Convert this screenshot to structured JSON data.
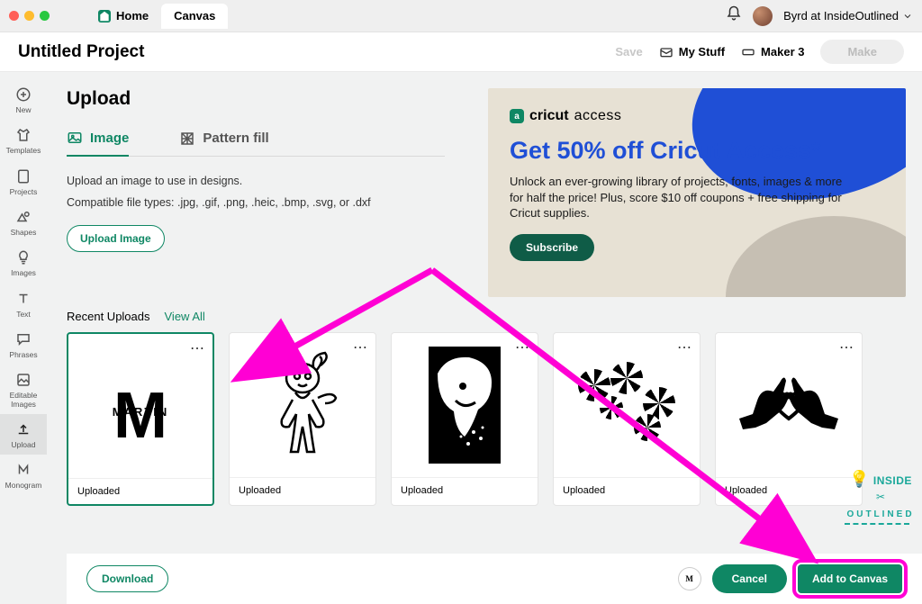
{
  "topbar": {
    "tabs": [
      {
        "label": "Home",
        "active": false
      },
      {
        "label": "Canvas",
        "active": true
      }
    ],
    "user_name": "Byrd at InsideOutlined"
  },
  "header": {
    "project_title": "Untitled Project",
    "save": "Save",
    "my_stuff": "My Stuff",
    "machine": "Maker 3",
    "make": "Make"
  },
  "sidebar": {
    "items": [
      {
        "label": "New"
      },
      {
        "label": "Templates"
      },
      {
        "label": "Projects"
      },
      {
        "label": "Shapes"
      },
      {
        "label": "Images"
      },
      {
        "label": "Text"
      },
      {
        "label": "Phrases"
      },
      {
        "label": "Editable Images"
      },
      {
        "label": "Upload"
      },
      {
        "label": "Monogram"
      }
    ],
    "active_index": 8
  },
  "page": {
    "title": "Upload",
    "tabs": {
      "image": "Image",
      "pattern": "Pattern fill"
    },
    "desc": "Upload an image to use in designs.",
    "types": "Compatible file types: .jpg, .gif, .png, .heic, .bmp, .svg, or .dxf",
    "upload_btn": "Upload Image"
  },
  "promo": {
    "brand_a": "cricut",
    "brand_b": "access",
    "title": "Get 50% off Cricut Access*",
    "desc": "Unlock an ever-growing library of projects, fonts, images & more for half the price! Plus, score $10 off coupons + free shipping for Cricut supplies.",
    "cta": "Subscribe"
  },
  "recent": {
    "label": "Recent Uploads",
    "view_all": "View All",
    "cards": [
      {
        "caption": "Uploaded",
        "monogram_text": "MARTIN",
        "selected": true
      },
      {
        "caption": "Uploaded"
      },
      {
        "caption": "Uploaded"
      },
      {
        "caption": "Uploaded"
      },
      {
        "caption": "Uploaded"
      }
    ]
  },
  "bottom": {
    "download": "Download",
    "cancel": "Cancel",
    "add": "Add to Canvas"
  },
  "watermark": {
    "l1": "INSIDE",
    "l2": "OUTLINED"
  }
}
